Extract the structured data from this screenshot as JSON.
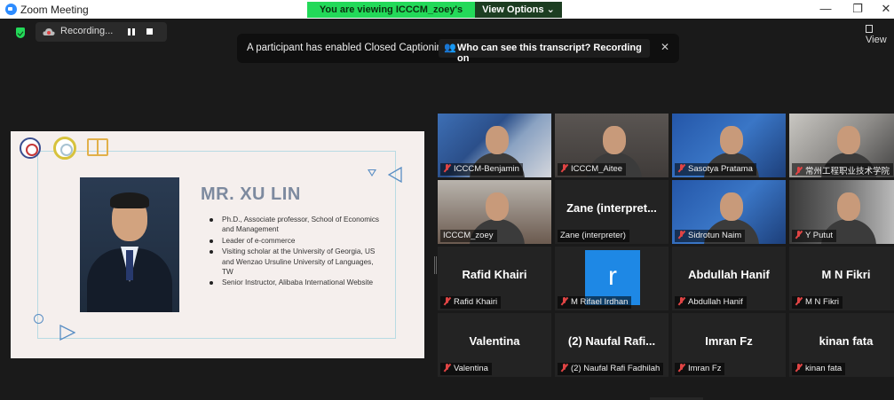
{
  "window": {
    "title": "Zoom Meeting",
    "minimize_glyph": "—",
    "maximize_glyph": "❐",
    "close_glyph": "✕"
  },
  "share_bar": {
    "viewing_text": "You are viewing ICCCM_zoey's screen",
    "view_options_label": "View Options ⌄"
  },
  "recording": {
    "label": "Recording...",
    "icon": "cloud-record-icon"
  },
  "caption_banner": {
    "message": "A participant has enabled Closed Captioning",
    "who_label": "Who can see this transcript? Recording on",
    "close_glyph": "✕"
  },
  "view_button": {
    "label": "View"
  },
  "slide": {
    "name": "MR. XU LIN",
    "bullets": [
      "Ph.D., Associate professor, School of Economics and Management",
      "Leader of e-commerce",
      "Visiting scholar at the University of Georgia, US and Wenzao Ursuline University of Languages, TW",
      "Senior Instructor, Alibaba International Website"
    ]
  },
  "participants": [
    {
      "display": "",
      "label": "ICCCM-Benjamin",
      "muted": true,
      "video": true
    },
    {
      "display": "",
      "label": "ICCCM_Aitee",
      "muted": true,
      "video": true
    },
    {
      "display": "",
      "label": "Sasotya Pratama",
      "muted": true,
      "video": true
    },
    {
      "display": "",
      "label": "常州工程职业技术学院",
      "muted": true,
      "video": true
    },
    {
      "display": "",
      "label": "ICCCM_zoey",
      "muted": false,
      "video": true,
      "active": true
    },
    {
      "display": "Zane  (interpret...",
      "label": "Zane (interpreter)",
      "muted": false,
      "video": false
    },
    {
      "display": "",
      "label": "Sidrotun Naim",
      "muted": true,
      "video": true
    },
    {
      "display": "",
      "label": "Y Putut",
      "muted": true,
      "video": true
    },
    {
      "display": "Rafid Khairi",
      "label": "Rafid Khairi",
      "muted": true,
      "video": false
    },
    {
      "display": "r",
      "label": "M Rifael Irdhan",
      "muted": true,
      "video": false,
      "avatar": true
    },
    {
      "display": "Abdullah Hanif",
      "label": "Abdullah Hanif",
      "muted": true,
      "video": false
    },
    {
      "display": "M N Fikri",
      "label": "M N Fikri",
      "muted": true,
      "video": false
    },
    {
      "display": "Valentina",
      "label": "Valentina",
      "muted": true,
      "video": false
    },
    {
      "display": "(2)  Naufal  Rafi...",
      "label": "(2) Naufal Rafi Fadhilah",
      "muted": true,
      "video": false
    },
    {
      "display": "Imran Fz",
      "label": "Imran Fz",
      "muted": true,
      "video": false
    },
    {
      "display": "kinan fata",
      "label": "kinan fata",
      "muted": true,
      "video": false
    }
  ],
  "collapse_glyph": "⌄",
  "colors": {
    "accent_green": "#23d959",
    "active_speaker": "#c9f23b",
    "muted_red": "#e04444",
    "avatar_blue": "#1e88e5"
  }
}
